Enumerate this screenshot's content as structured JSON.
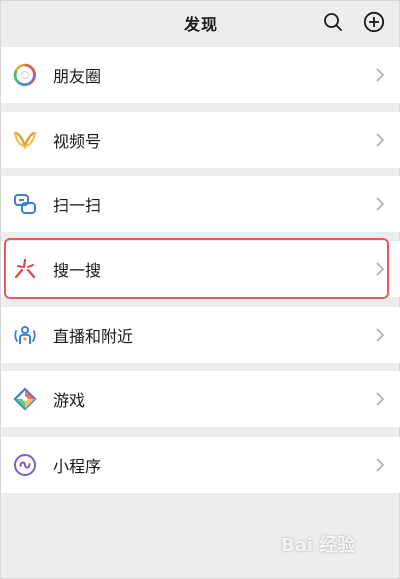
{
  "header": {
    "title": "发现",
    "search_icon": "search-icon",
    "add_icon": "plus-circle-icon"
  },
  "items": [
    {
      "label": "朋友圈",
      "icon": "moments-icon"
    },
    {
      "label": "视频号",
      "icon": "channels-icon"
    },
    {
      "label": "扫一扫",
      "icon": "scan-icon"
    },
    {
      "label": "搜一搜",
      "icon": "search-search-icon"
    },
    {
      "label": "直播和附近",
      "icon": "live-nearby-icon"
    },
    {
      "label": "游戏",
      "icon": "games-icon"
    },
    {
      "label": "小程序",
      "icon": "mini-programs-icon"
    }
  ],
  "colors": {
    "background": "#ededed",
    "highlight_border": "#e85a63",
    "chevron": "#b2b2b2"
  },
  "watermark": "Bai 经验"
}
